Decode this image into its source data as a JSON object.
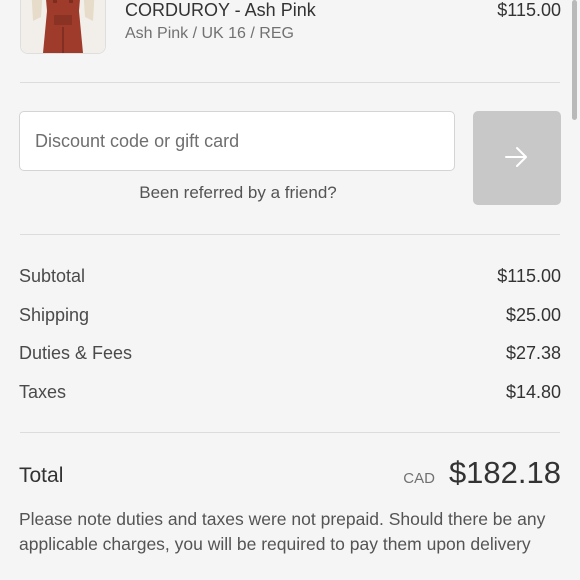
{
  "product": {
    "name": "CORDUROY - Ash Pink",
    "variant": "Ash Pink / UK 16 / REG",
    "price": "$115.00",
    "image_icon": "product-thumbnail"
  },
  "discount": {
    "placeholder": "Discount code or gift card",
    "value": "",
    "apply_icon": "arrow-right-icon",
    "apply_button_color": "#c8c8c8",
    "referral_link": "Been referred by a friend?"
  },
  "summary": {
    "rows": [
      {
        "label": "Subtotal",
        "value": "$115.00"
      },
      {
        "label": "Shipping",
        "value": "$25.00"
      },
      {
        "label": "Duties & Fees",
        "value": "$27.38"
      },
      {
        "label": "Taxes",
        "value": "$14.80"
      }
    ],
    "total_label": "Total",
    "currency": "CAD",
    "total_value": "$182.18"
  },
  "note": "Please note duties and taxes were not prepaid. Should there be any applicable charges, you will be required to pay them upon delivery"
}
